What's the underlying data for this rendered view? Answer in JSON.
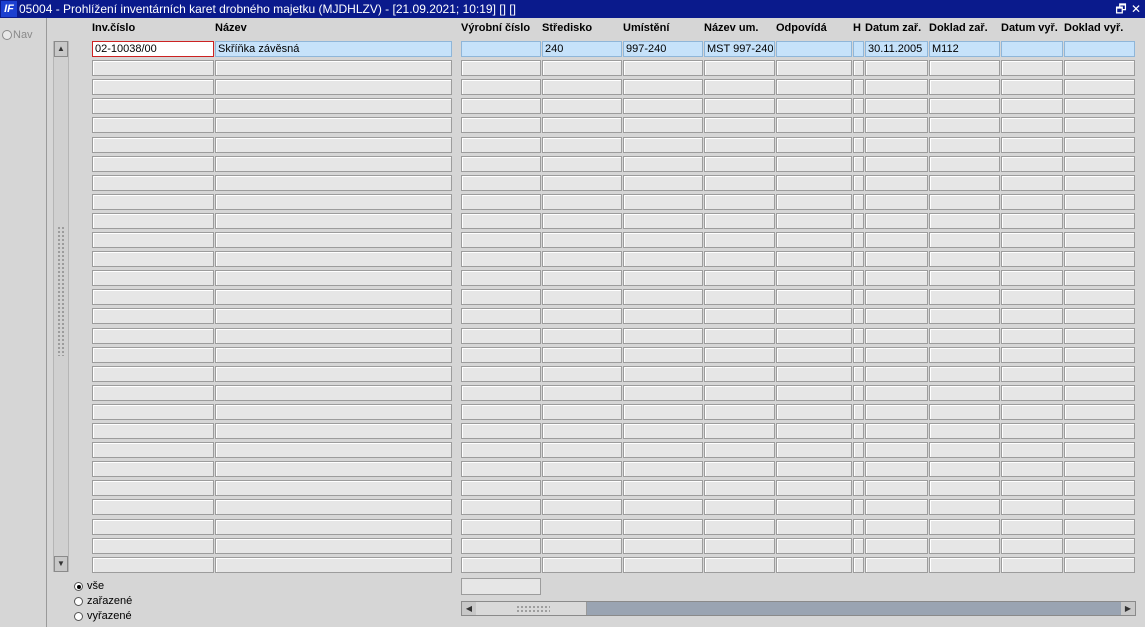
{
  "window": {
    "app_icon_text": "IF",
    "title": "05004 - Prohlížení inventárních karet drobného majetku (MJDHLZV) - [21.09.2021; 10:19]  []  []",
    "restore_glyph": "🗗",
    "close_glyph": "✕"
  },
  "left_pane": {
    "nav_label": "Nav"
  },
  "columns": [
    {
      "key": "inv_cislo",
      "label": "Inv.číslo"
    },
    {
      "key": "nazev",
      "label": "Název"
    },
    {
      "key": "vyrobni_cislo",
      "label": "Výrobní číslo"
    },
    {
      "key": "stredisko",
      "label": "Středisko"
    },
    {
      "key": "umisteni",
      "label": "Umístění"
    },
    {
      "key": "nazev_um",
      "label": "Název um."
    },
    {
      "key": "odpovida",
      "label": "Odpovídá"
    },
    {
      "key": "h",
      "label": "H"
    },
    {
      "key": "datum_zar",
      "label": "Datum zař."
    },
    {
      "key": "doklad_zar",
      "label": "Doklad zař."
    },
    {
      "key": "datum_vyr",
      "label": "Datum vyř."
    },
    {
      "key": "doklad_vyr",
      "label": "Doklad vyř."
    }
  ],
  "rows": [
    [
      "02-10038/00",
      "Skříňka závěsná",
      "",
      "240",
      "997-240",
      "MST 997-240",
      "",
      "",
      "30.11.2005",
      "M112",
      "",
      ""
    ]
  ],
  "visible_row_count": 28,
  "filter": {
    "options": [
      {
        "label": "vše",
        "selected": true
      },
      {
        "label": "zařazené",
        "selected": false
      },
      {
        "label": "vyřazené",
        "selected": false
      }
    ]
  },
  "scroll": {
    "up_glyph": "▲",
    "down_glyph": "▼",
    "left_glyph": "◀",
    "right_glyph": "▶"
  },
  "colors": {
    "title_bar": "#0a1a8c",
    "current_row": "#c6e2fa",
    "focus_border": "#cc2222",
    "empty_cell": "#e6e6e6"
  }
}
